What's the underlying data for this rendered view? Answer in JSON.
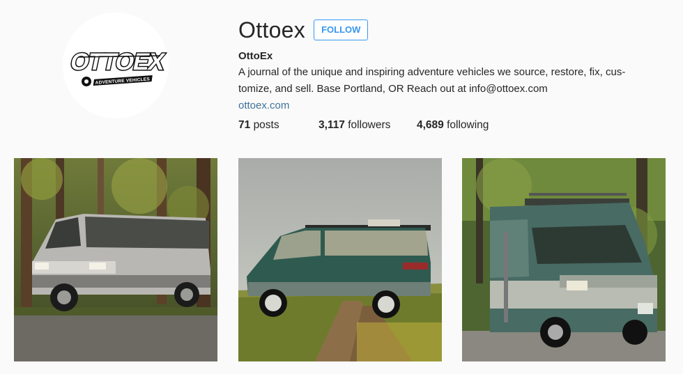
{
  "profile": {
    "username": "Ottoex",
    "follow_label": "FOLLOW",
    "full_name": "OttoEx",
    "bio_line1": "A journal of the unique and inspiring adventure vehicles we source, restore, fix, cus-",
    "bio_line2": "tomize, and sell. Base Portland, OR Reach out at info@ottoex.com",
    "website": "ottoex.com",
    "logo_text": "OTTOEX",
    "logo_tagline": "ADVENTURE VEHICLES"
  },
  "stats": {
    "posts_count": "71",
    "posts_label": "posts",
    "followers_count": "3,117",
    "followers_label": "followers",
    "following_count": "4,689",
    "following_label": "following"
  },
  "colors": {
    "accent": "#3897f0",
    "link": "#3f729b",
    "background": "#fafafa"
  },
  "posts": [
    {
      "subject": "silver Toyota HiAce van in forest"
    },
    {
      "subject": "green Toyota Previa with roof rack on dirt road"
    },
    {
      "subject": "two-tone green camper van with roof rack in forest"
    }
  ]
}
